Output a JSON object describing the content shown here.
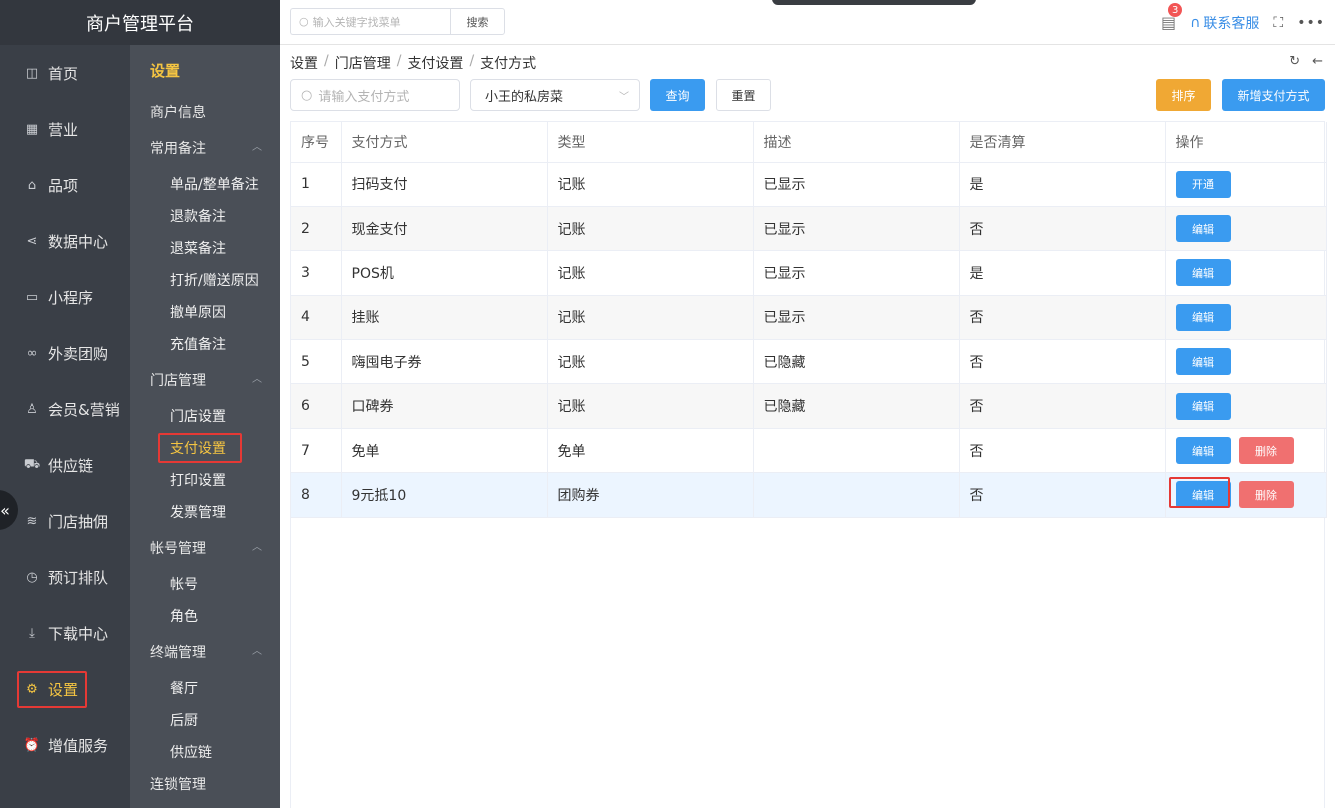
{
  "brand": "商户管理平台",
  "topbar": {
    "search_placeholder": "输入关键字找菜单",
    "search_button": "搜索",
    "message_count": "3",
    "service_label": "联系客服"
  },
  "nav1": [
    {
      "label": "首页",
      "icon": "home-icon",
      "glyph": "◫"
    },
    {
      "label": "营业",
      "icon": "calendar-icon",
      "glyph": "▦"
    },
    {
      "label": "品项",
      "icon": "bag-icon",
      "glyph": "⌂"
    },
    {
      "label": "数据中心",
      "icon": "share-icon",
      "glyph": "⋖"
    },
    {
      "label": "小程序",
      "icon": "phone-icon",
      "glyph": "▭"
    },
    {
      "label": "外卖团购",
      "icon": "bike-icon",
      "glyph": "∞"
    },
    {
      "label": "会员&营销",
      "icon": "user-icon",
      "glyph": "♙"
    },
    {
      "label": "供应链",
      "icon": "truck-icon",
      "glyph": "⛟"
    },
    {
      "label": "门店抽佣",
      "icon": "database-icon",
      "glyph": "≋"
    },
    {
      "label": "预订排队",
      "icon": "clock-icon",
      "glyph": "◷"
    },
    {
      "label": "下载中心",
      "icon": "download-icon",
      "glyph": "⤓"
    },
    {
      "label": "设置",
      "icon": "gear-icon",
      "glyph": "⚙"
    },
    {
      "label": "增值服务",
      "icon": "alarm-icon",
      "glyph": "⏰"
    }
  ],
  "nav2": {
    "title": "设置",
    "merchant_info": "商户信息",
    "groups": [
      {
        "label": "常用备注",
        "subs": [
          "单品/整单备注",
          "退款备注",
          "退菜备注",
          "打折/赠送原因",
          "撤单原因",
          "充值备注"
        ]
      },
      {
        "label": "门店管理",
        "subs": [
          "门店设置",
          "支付设置",
          "打印设置",
          "发票管理"
        ]
      },
      {
        "label": "帐号管理",
        "subs": [
          "帐号",
          "角色"
        ]
      },
      {
        "label": "终端管理",
        "subs": [
          "餐厅",
          "后厨",
          "供应链"
        ]
      },
      {
        "label": "连锁管理",
        "subs": []
      }
    ]
  },
  "breadcrumb": [
    "设置",
    "门店管理",
    "支付设置",
    "支付方式"
  ],
  "filters": {
    "pay_placeholder": "请输入支付方式",
    "store_selected": "小王的私房菜",
    "query": "查询",
    "reset": "重置",
    "sort": "排序",
    "add": "新增支付方式"
  },
  "table": {
    "headers": [
      "序号",
      "支付方式",
      "类型",
      "描述",
      "是否清算",
      "操作"
    ],
    "rows": [
      {
        "no": "1",
        "method": "扫码支付",
        "type": "记账",
        "desc": "已显示",
        "settle": "是",
        "ops": [
          "开通"
        ]
      },
      {
        "no": "2",
        "method": "现金支付",
        "type": "记账",
        "desc": "已显示",
        "settle": "否",
        "ops": [
          "编辑"
        ]
      },
      {
        "no": "3",
        "method": "POS机",
        "type": "记账",
        "desc": "已显示",
        "settle": "是",
        "ops": [
          "编辑"
        ]
      },
      {
        "no": "4",
        "method": "挂账",
        "type": "记账",
        "desc": "已显示",
        "settle": "否",
        "ops": [
          "编辑"
        ]
      },
      {
        "no": "5",
        "method": "嗨囤电子券",
        "type": "记账",
        "desc": "已隐藏",
        "settle": "否",
        "ops": [
          "编辑"
        ]
      },
      {
        "no": "6",
        "method": "口碑券",
        "type": "记账",
        "desc": "已隐藏",
        "settle": "否",
        "ops": [
          "编辑"
        ]
      },
      {
        "no": "7",
        "method": "免单",
        "type": "免单",
        "desc": "",
        "settle": "否",
        "ops": [
          "编辑",
          "删除"
        ]
      },
      {
        "no": "8",
        "method": "9元抵10",
        "type": "团购券",
        "desc": "",
        "settle": "否",
        "ops": [
          "编辑",
          "删除"
        ]
      }
    ]
  }
}
